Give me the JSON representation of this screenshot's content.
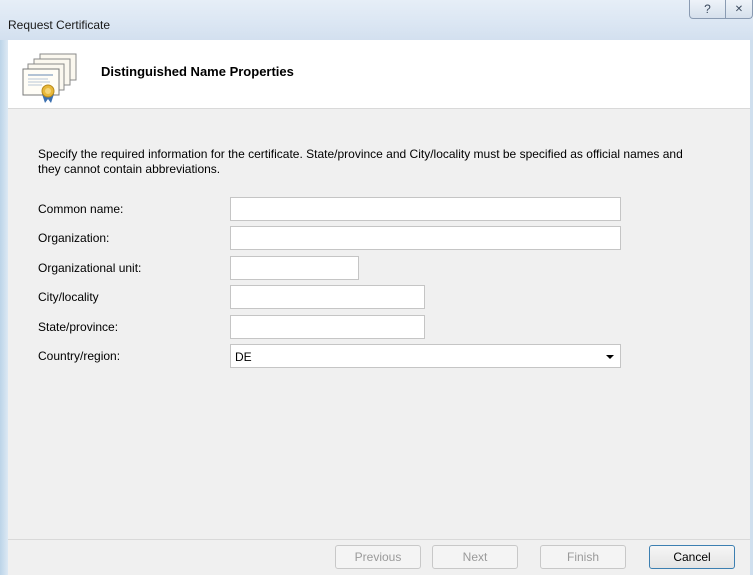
{
  "window": {
    "title": "Request Certificate",
    "help_glyph": "?",
    "close_glyph": "✕"
  },
  "header": {
    "icon": "certificate-icon",
    "title": "Distinguished Name Properties"
  },
  "description": "Specify the required information for the certificate. State/province and City/locality must be specified as official names and they cannot contain abbreviations.",
  "form": {
    "common_name": {
      "label": "Common name:",
      "value": ""
    },
    "organization": {
      "label": "Organization:",
      "value": ""
    },
    "organizational_unit": {
      "label": "Organizational unit:",
      "value": ""
    },
    "city": {
      "label": "City/locality",
      "value": ""
    },
    "state": {
      "label": "State/province:",
      "value": ""
    },
    "country": {
      "label": "Country/region:",
      "value": "DE"
    }
  },
  "buttons": {
    "previous": "Previous",
    "next": "Next",
    "finish": "Finish",
    "cancel": "Cancel"
  }
}
